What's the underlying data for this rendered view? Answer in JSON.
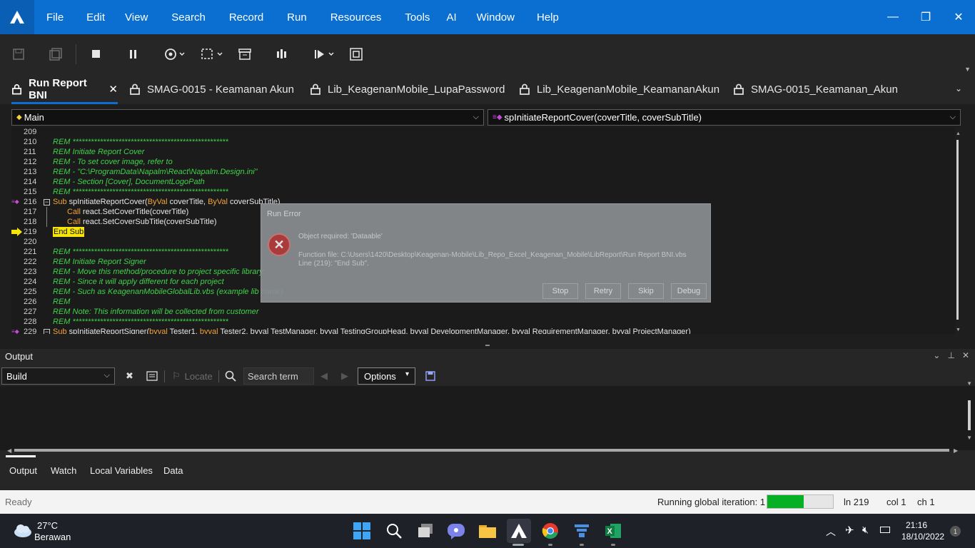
{
  "app_window": {
    "menu": [
      "File",
      "Edit",
      "View",
      "Search",
      "Record",
      "Run",
      "Resources",
      "Tools",
      "AI",
      "Window",
      "Help"
    ],
    "window_controls": {
      "minimize": "—",
      "restore": "❐",
      "close": "✕"
    }
  },
  "tabs": [
    {
      "label": "Run Report BNI",
      "active": true,
      "close": "✕"
    },
    {
      "label": "SMAG-0015 - Keamanan Akun"
    },
    {
      "label": "Lib_KeagenanMobile_LupaPassword"
    },
    {
      "label": "Lib_KeagenanMobile_KeamananAkun"
    },
    {
      "label": "SMAG-0015_Keamanan_Akun"
    }
  ],
  "editor": {
    "scope_combo": "Main",
    "proc_combo": "spInitiateReportCover(coverTitle, coverSubTitle)",
    "lines": [
      {
        "n": "209",
        "t": ""
      },
      {
        "n": "210",
        "t": "REM ***************************************************",
        "c": "rem"
      },
      {
        "n": "211",
        "t": "REM Initiate Report Cover",
        "c": "rem"
      },
      {
        "n": "212",
        "t": "REM - To set cover image, refer to",
        "c": "rem"
      },
      {
        "n": "213",
        "t": "REM - \"C:\\ProgramData\\Napalm\\React\\Napalm.Design.ini\"",
        "c": "rem"
      },
      {
        "n": "214",
        "t": "REM - Section [Cover], DocumentLogoPath",
        "c": "rem"
      },
      {
        "n": "215",
        "t": "REM ***************************************************",
        "c": "rem"
      },
      {
        "n": "216",
        "k1": "Sub",
        "t": " spInitiateReportCover(",
        "k2": "ByVal",
        "t2": " coverTitle, ",
        "k3": "ByVal",
        "t3": " coverSubTitle)"
      },
      {
        "n": "217",
        "k1": "Call",
        "t": " react.SetCoverTitle(coverTitle)",
        "indent": true
      },
      {
        "n": "218",
        "k1": "Call",
        "t": " react.SetCoverSubTitle(coverSubTitle)",
        "indent": true
      },
      {
        "n": "219",
        "t": "End Sub",
        "hl": true
      },
      {
        "n": "220",
        "t": ""
      },
      {
        "n": "221",
        "t": "REM ***************************************************",
        "c": "rem"
      },
      {
        "n": "222",
        "t": "REM Initiate Report Signer",
        "c": "rem"
      },
      {
        "n": "223",
        "t": "REM - Move this method/procedure to project specific library,",
        "c": "rem"
      },
      {
        "n": "224",
        "t": "REM - Since it will apply different for each project",
        "c": "rem"
      },
      {
        "n": "225",
        "t": "REM - Such as KeagenanMobileGlobalLib.vbs (example lib name)",
        "c": "rem"
      },
      {
        "n": "226",
        "t": "REM",
        "c": "rem"
      },
      {
        "n": "227",
        "t": "REM Note: This information will be collected from customer",
        "c": "rem"
      },
      {
        "n": "228",
        "t": "REM ***************************************************",
        "c": "rem"
      },
      {
        "n": "229",
        "k1": "Sub",
        "t": " spInitiateReportSigner(",
        "k2": "byval",
        "t2": " Tester1, ",
        "k3": "byval",
        "t3": " Tester2, byval TestManager, byval TestingGroupHead, byval DevelopmentManager, byval RequirementManager, byval ProjectManager)"
      }
    ]
  },
  "dialog": {
    "title": "Run Error",
    "message": "Object required: 'Dataable'",
    "file": "Function file: C:\\Users\\1420\\Desktop\\Keagenan-Mobile\\Lib_Repo_Excel_Keagenan_Mobile\\LibReport\\Run Report BNI.vbs",
    "line": "Line (219): \"End Sub\".",
    "buttons": [
      "Stop",
      "Retry",
      "Skip",
      "Debug"
    ]
  },
  "output": {
    "title": "Output",
    "source": "Build",
    "locate": "Locate",
    "search_placeholder": "Search term",
    "options": "Options",
    "bottom_tabs": [
      "Output",
      "Watch",
      "Local Variables",
      "Data"
    ]
  },
  "status": {
    "ready": "Ready",
    "iteration": "Running global iteration: 1",
    "progress": 0.55,
    "ln": "ln 219",
    "col": "col 1",
    "ch": "ch 1"
  },
  "taskbar": {
    "weather_temp": "27°C",
    "weather_desc": "Berawan",
    "time": "21:16",
    "date": "18/10/2022",
    "notif": "1"
  }
}
